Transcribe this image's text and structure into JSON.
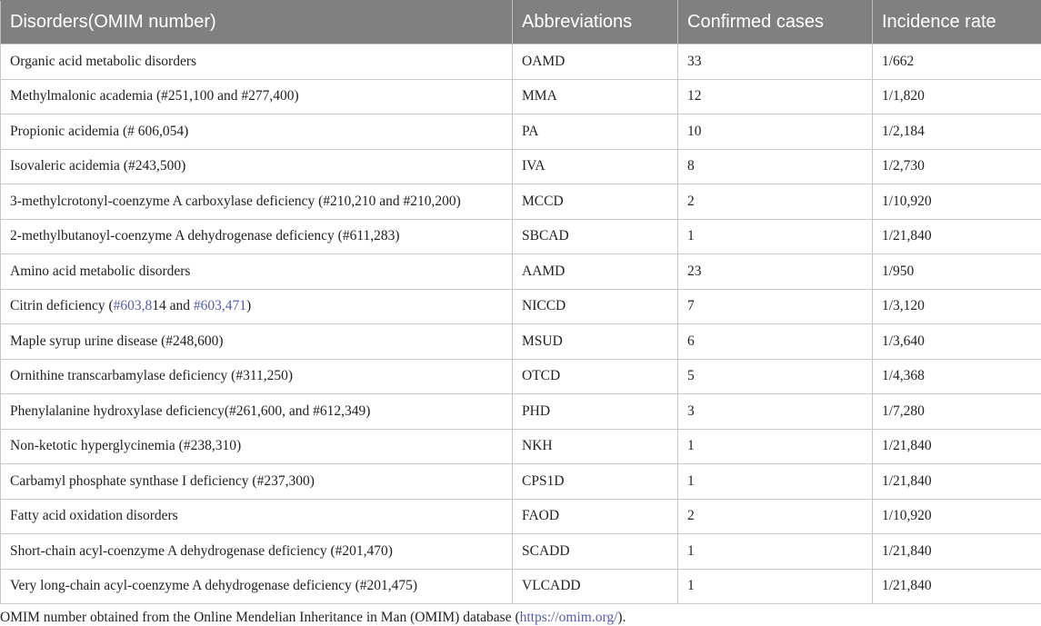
{
  "table": {
    "headers": [
      "Disorders(OMIM number)",
      "Abbreviations",
      "Confirmed cases",
      "Incidence rate"
    ],
    "rows": [
      {
        "disorder": "Organic acid metabolic disorders",
        "abbr": "OAMD",
        "cases": "33",
        "rate": "1/662"
      },
      {
        "disorder": "Methylmalonic academia (#251,100 and #277,400)",
        "abbr": "MMA",
        "cases": "12",
        "rate": "1/1,820"
      },
      {
        "disorder": "Propionic acidemia (# 606,054)",
        "abbr": "PA",
        "cases": "10",
        "rate": "1/2,184"
      },
      {
        "disorder": "Isovaleric acidemia (#243,500)",
        "abbr": "IVA",
        "cases": "8",
        "rate": "1/2,730"
      },
      {
        "disorder": "3-methylcrotonyl-coenzyme A carboxylase deficiency (#210,210 and #210,200)",
        "abbr": "MCCD",
        "cases": "2",
        "rate": "1/10,920"
      },
      {
        "disorder": "2-methylbutanoyl-coenzyme A dehydrogenase deficiency (#611,283)",
        "abbr": "SBCAD",
        "cases": "1",
        "rate": "1/21,840"
      },
      {
        "disorder": "Amino acid metabolic disorders",
        "abbr": "AAMD",
        "cases": "23",
        "rate": "1/950"
      },
      {
        "disorder_parts": [
          "Citrin deficiency (",
          "#603,8",
          "14 and ",
          "#603,471",
          ")"
        ],
        "abbr": "NICCD",
        "cases": "7",
        "rate": "1/3,120"
      },
      {
        "disorder": "Maple syrup urine disease (#248,600)",
        "abbr": "MSUD",
        "cases": "6",
        "rate": "1/3,640"
      },
      {
        "disorder": "Ornithine transcarbamylase deficiency (#311,250)",
        "abbr": "OTCD",
        "cases": "5",
        "rate": "1/4,368"
      },
      {
        "disorder": "Phenylalanine hydroxylase deficiency(#261,600, and #612,349)",
        "abbr": "PHD",
        "cases": "3",
        "rate": "1/7,280"
      },
      {
        "disorder": "Non-ketotic hyperglycinemia (#238,310)",
        "abbr": "NKH",
        "cases": "1",
        "rate": "1/21,840"
      },
      {
        "disorder": "Carbamyl phosphate synthase I deficiency (#237,300)",
        "abbr": "CPS1D",
        "cases": "1",
        "rate": "1/21,840"
      },
      {
        "disorder": "Fatty acid oxidation disorders",
        "abbr": "FAOD",
        "cases": "2",
        "rate": "1/10,920"
      },
      {
        "disorder": "Short-chain acyl-coenzyme A dehydrogenase deficiency (#201,470)",
        "abbr": "SCADD",
        "cases": "1",
        "rate": "1/21,840"
      },
      {
        "disorder": "Very long-chain acyl-coenzyme A dehydrogenase deficiency (#201,475)",
        "abbr": "VLCADD",
        "cases": "1",
        "rate": "1/21,840"
      }
    ]
  },
  "footnote": {
    "text_before": "OMIM number obtained from the Online Mendelian Inheritance in Man (OMIM) database (",
    "link": "https://omim.org/",
    "text_after": ")."
  }
}
